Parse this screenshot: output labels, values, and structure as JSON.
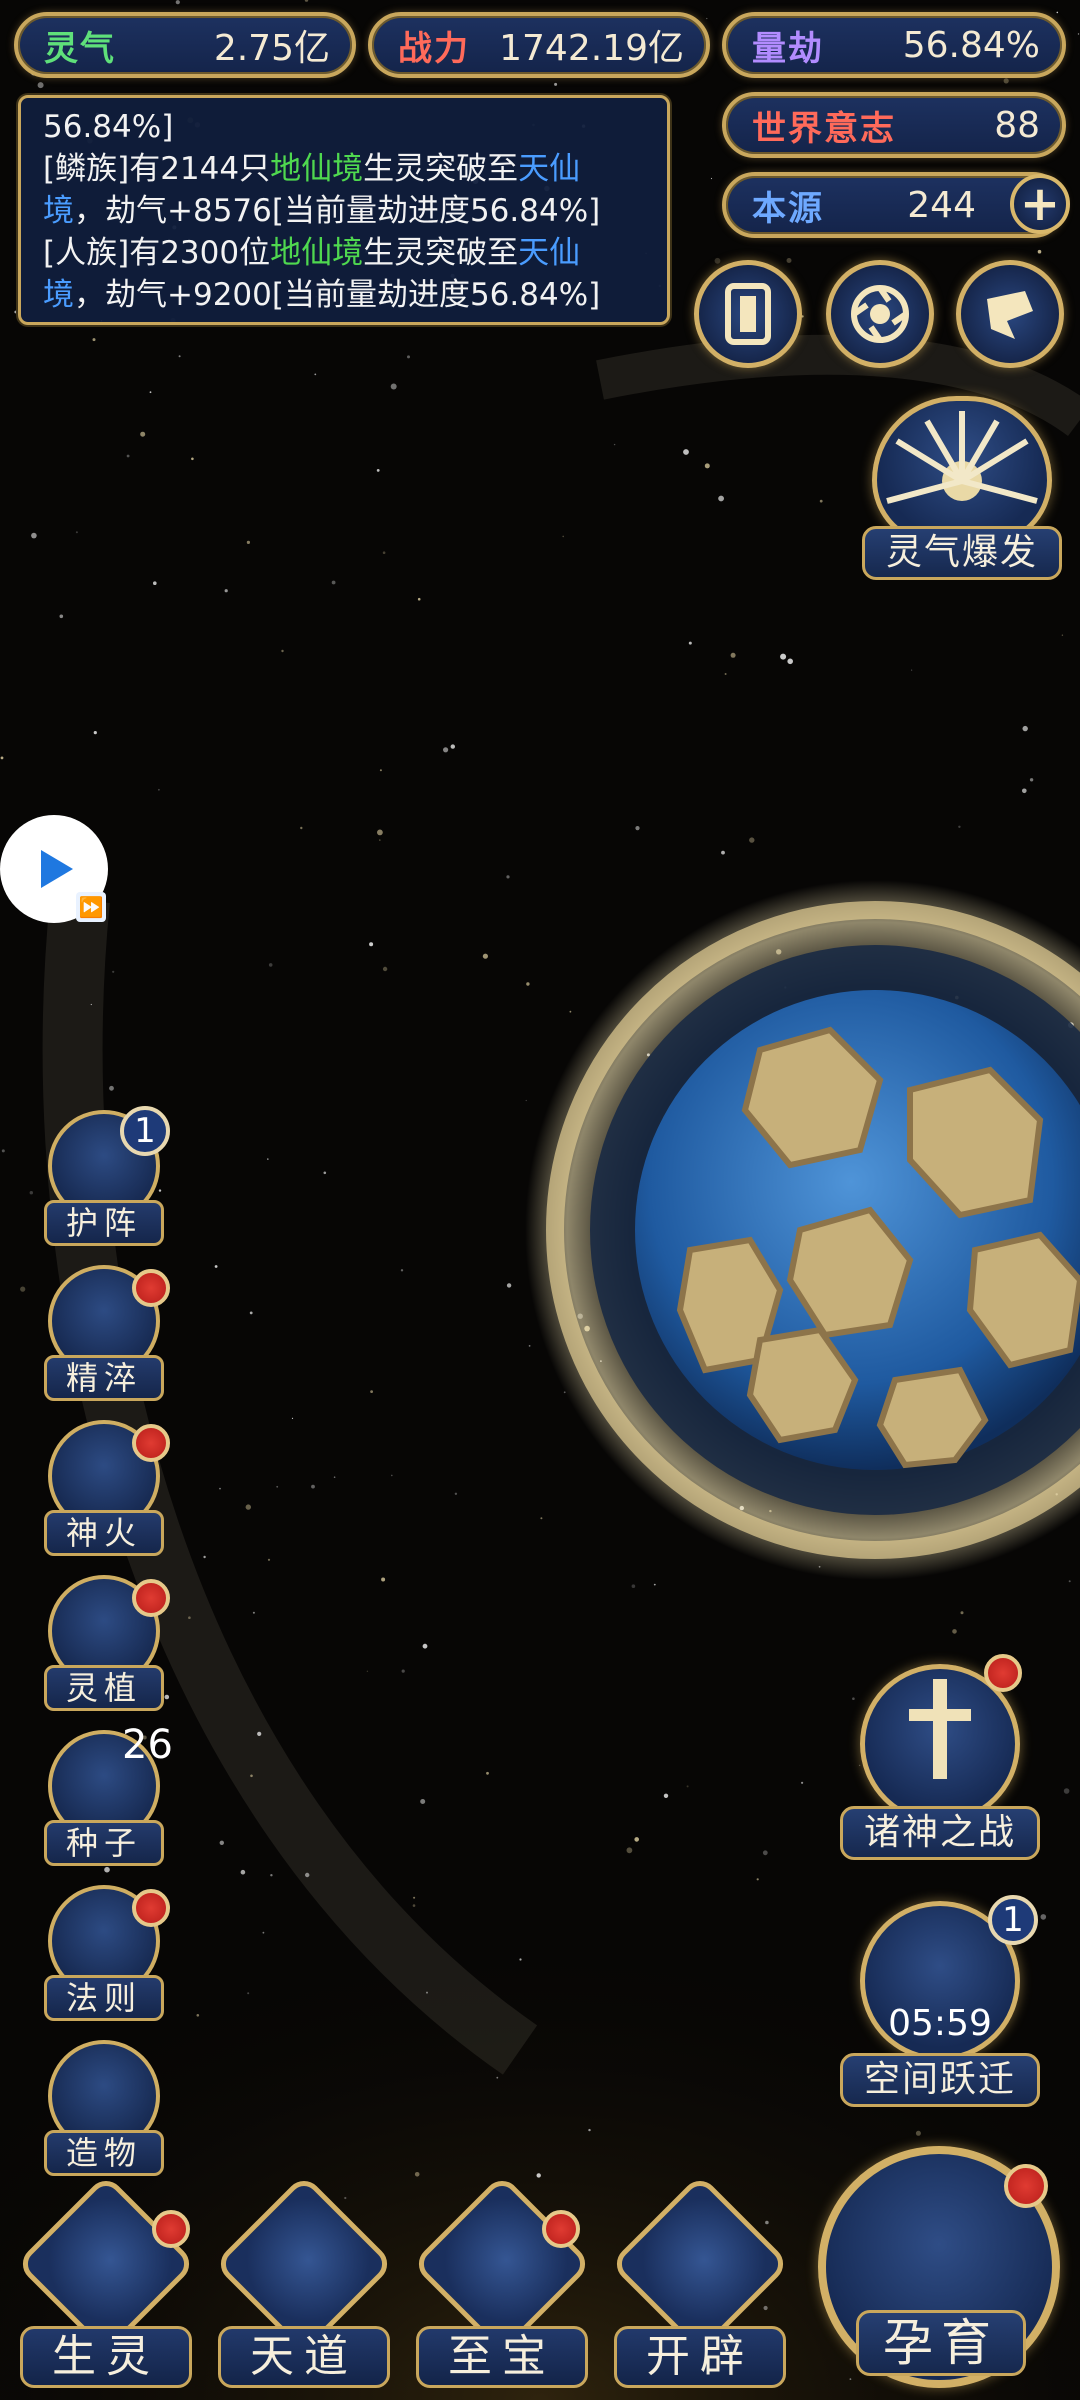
{
  "resources": {
    "lingqi": {
      "label": "灵气",
      "value": "2.75亿",
      "color": "#5fe07a"
    },
    "zhanli": {
      "label": "战力",
      "value": "1742.19亿",
      "color": "#ff6a5a"
    },
    "lianjie": {
      "label": "量劫",
      "value": "56.84%",
      "color": "#b28cff"
    },
    "shijie_yizhi": {
      "label": "世界意志",
      "value": "88",
      "color": "#ff6a5a"
    },
    "benyuan": {
      "label": "本源",
      "value": "244",
      "color": "#6ea9ff"
    }
  },
  "event_log": {
    "top_line": "56.84%]",
    "entries": [
      {
        "prefix": "[鳞族]有2144只",
        "realm_from": "地仙境",
        "middle": "生灵突破至",
        "realm_to": "天仙",
        "realm_to_tail": "境",
        "suffix": "，劫气+8576[当前量劫进度56.84%]"
      },
      {
        "prefix": "[人族]有2300位",
        "realm_from": "地仙境",
        "middle": "生灵突破至",
        "realm_to": "天仙",
        "realm_to_tail": "境",
        "suffix": "，劫气+9200[当前量劫进度56.84%]"
      }
    ]
  },
  "side_menu": [
    {
      "label": "护阵",
      "badge": "1"
    },
    {
      "label": "精淬",
      "badge": ""
    },
    {
      "label": "神火",
      "badge": ""
    },
    {
      "label": "灵植",
      "badge": ""
    },
    {
      "label": "种子",
      "badge": "26"
    },
    {
      "label": "法则",
      "badge": ""
    },
    {
      "label": "造物",
      "badge": ""
    }
  ],
  "features": {
    "burst": {
      "label": "灵气爆发"
    },
    "war": {
      "label": "诸神之战"
    },
    "jump": {
      "label": "空间跃迁",
      "timer": "05:59",
      "badge": "1"
    },
    "nurture": {
      "label": "孕育"
    }
  },
  "bottom_nav": [
    {
      "label": "生灵"
    },
    {
      "label": "天道"
    },
    {
      "label": "至宝"
    },
    {
      "label": "开辟"
    }
  ],
  "plus_symbol": "+",
  "icons": {
    "video": "play-icon",
    "fast_forward": "⏩"
  }
}
